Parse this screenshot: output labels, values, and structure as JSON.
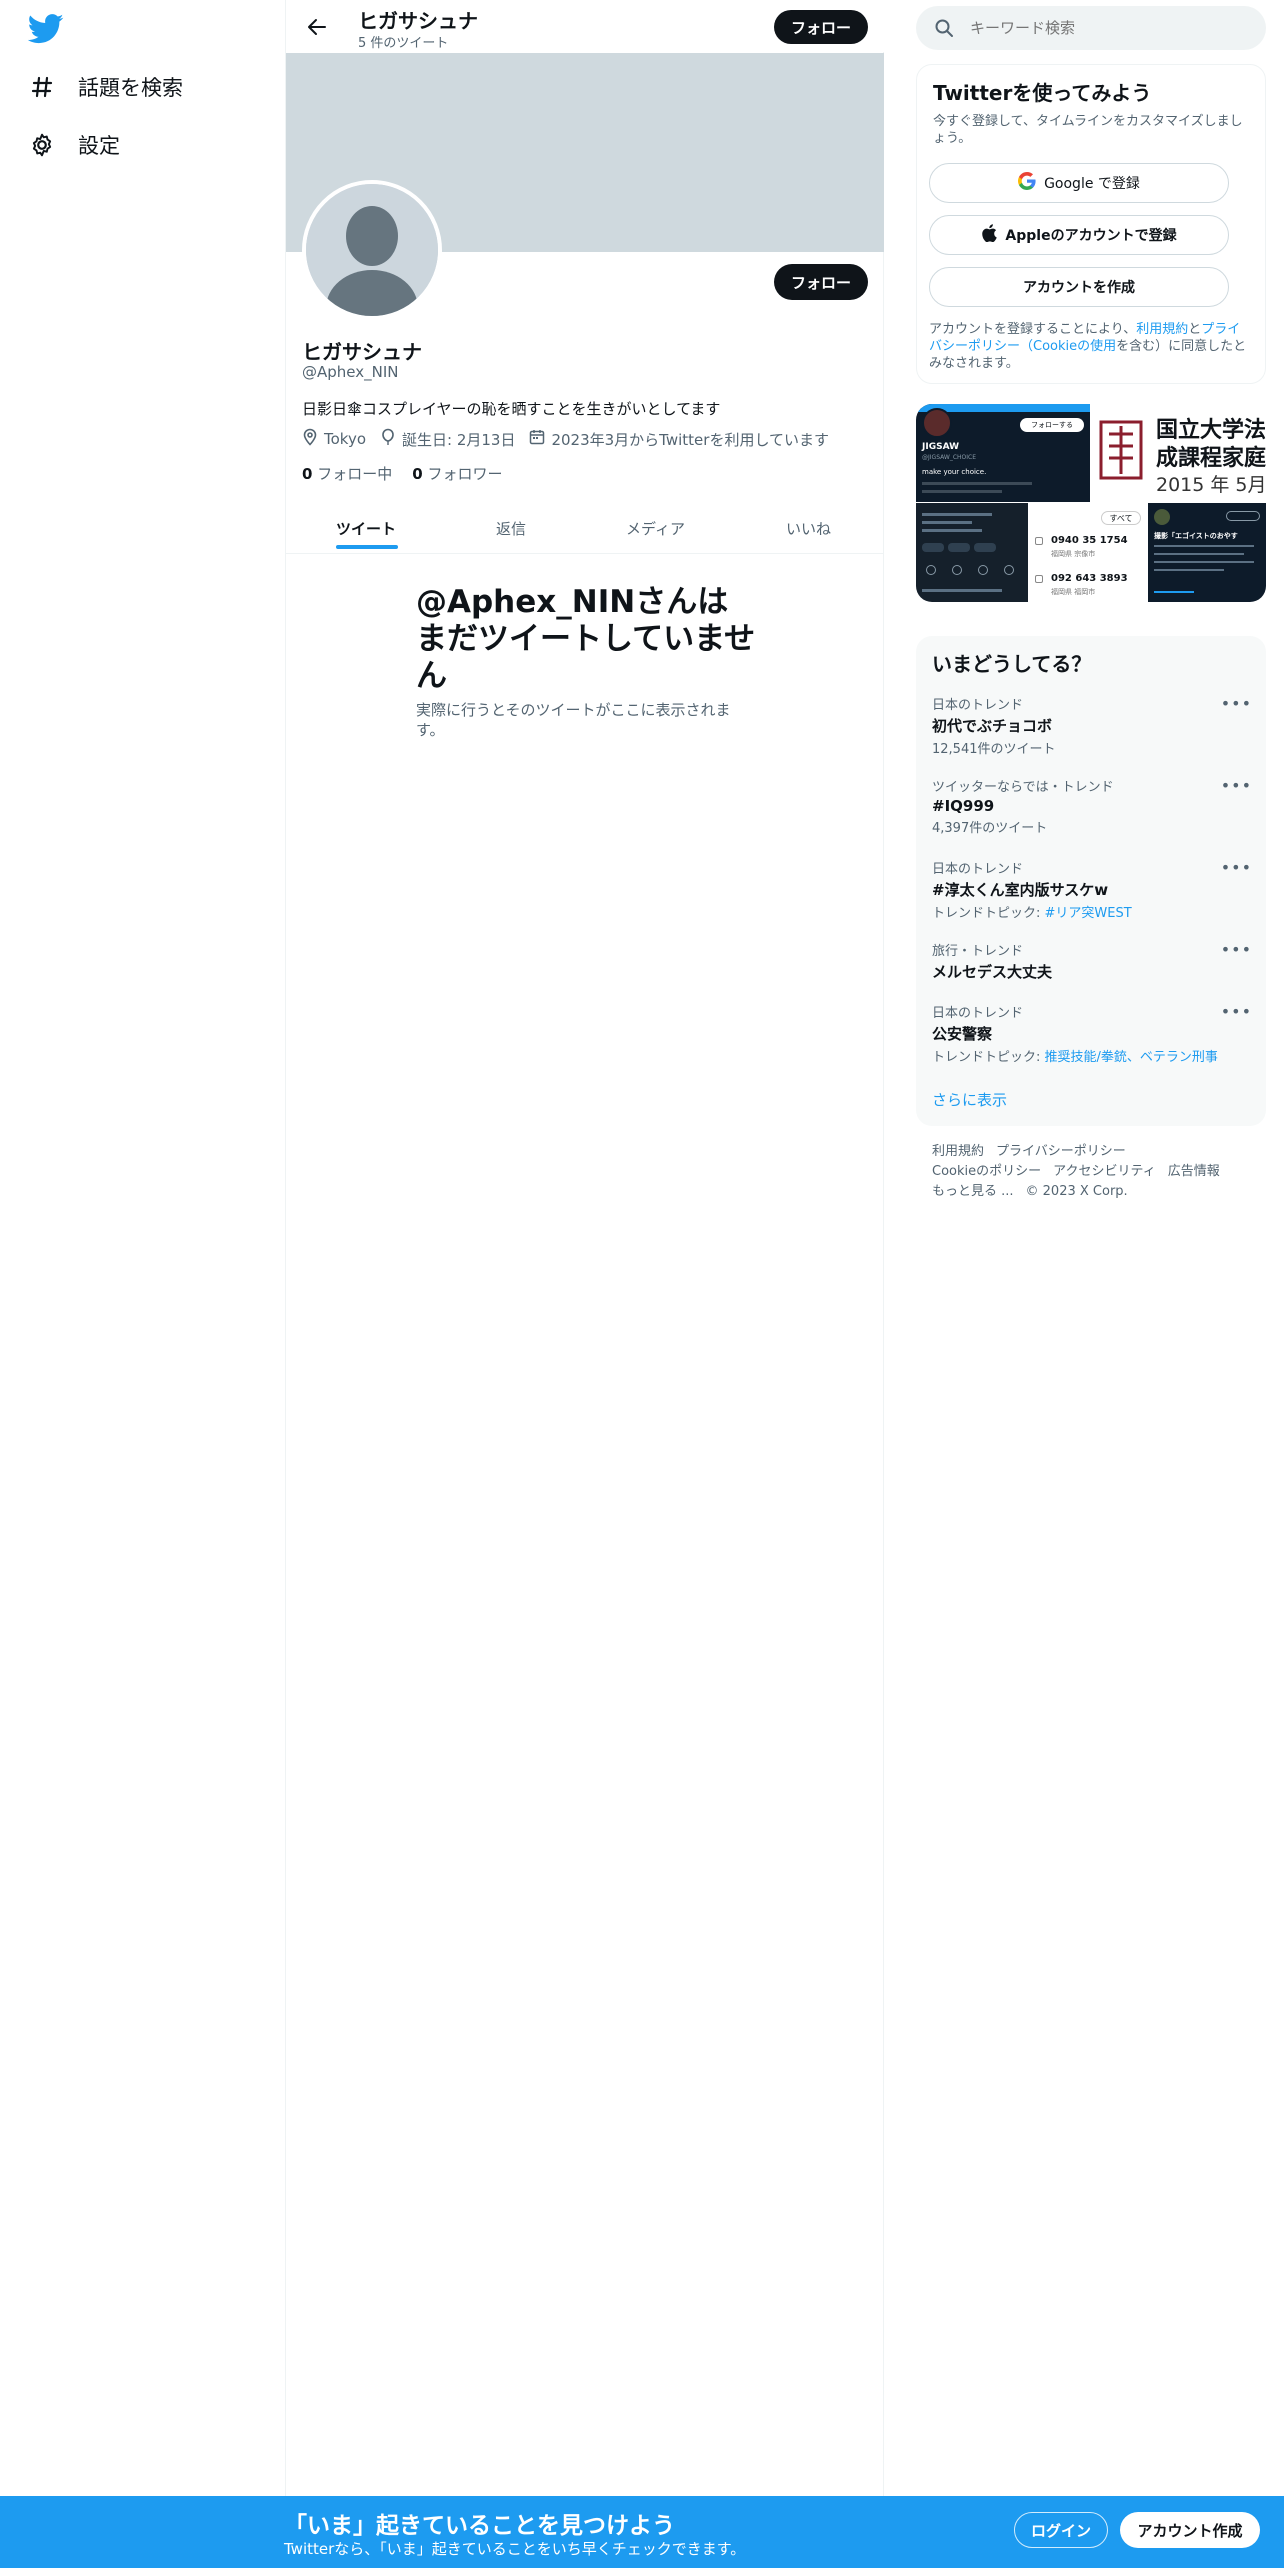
{
  "sidebar": {
    "logo": "twitter-bird-icon",
    "items": [
      {
        "icon": "hashtag-icon",
        "label": "話題を検索"
      },
      {
        "icon": "gear-icon",
        "label": "設定"
      }
    ]
  },
  "header": {
    "name": "ヒガサシュナ",
    "tweet_count": "5 件のツイート",
    "follow_label": "フォロー"
  },
  "profile": {
    "follow_label": "フォロー",
    "display_name": "ヒガサシュナ",
    "handle": "@Aphex_NIN",
    "bio": "日影日傘コスプレイヤーの恥を晒すことを生きがいとしてます",
    "location": "Tokyo",
    "birthday": "誕生日: 2月13日",
    "joined": "2023年3月からTwitterを利用しています",
    "following_count": "0",
    "following_label": "フォロー中",
    "followers_count": "0",
    "followers_label": "フォロワー"
  },
  "tabs": [
    "ツイート",
    "返信",
    "メディア",
    "いいね"
  ],
  "empty_state": {
    "title": "@Aphex_NINさんはまだツイートしていません",
    "subtitle": "実際に行うとそのツイートがここに表示されます。"
  },
  "search": {
    "placeholder": "キーワード検索"
  },
  "signup_box": {
    "title": "Twitterを使ってみよう",
    "subtitle": "今すぐ登録して、タイムラインをカスタマイズしましょう。",
    "google_label": "Google で登録",
    "apple_label": "Appleのアカウントで登録",
    "create_label": "アカウントを作成",
    "legal_pre": "アカウントを登録することにより、",
    "legal_terms": "利用規約",
    "legal_and": "と",
    "legal_privacy": "プライバシーポリシー（Cookieの使用",
    "legal_post": "を含む）に同意したとみなされます。"
  },
  "media": {
    "tile1_name": "JIGSAW",
    "tile1_handle": "@JIGSAW_CHOICE",
    "tile1_text": "make your choice.",
    "tile1_button": "フォローする",
    "tile3_line1": "国立大学法",
    "tile3_line2": "成課程家庭",
    "tile3_line3": "2015 年 5月〜",
    "tile5_button": "すべて",
    "tile5_phone1": "0940 35 1754",
    "tile5_place1": "福岡県 宗像市",
    "tile5_phone2": "092 643 3893",
    "tile5_place2": "福岡県 福岡市",
    "tile6_title": "撮影「エゴイストのおやす"
  },
  "trends": {
    "title": "いまどうしてる？",
    "items": [
      {
        "context": "日本のトレンド",
        "name": "初代でぶチョコボ",
        "count": "12,541件のツイート"
      },
      {
        "context": "ツイッターならでは・トレンド",
        "name": "#IQ999",
        "count": "4,397件のツイート"
      },
      {
        "context": "日本のトレンド",
        "name": "#淳太くん室内版サスケw",
        "topic_label": "トレンドトピック: ",
        "topic": "#リア突WEST"
      },
      {
        "context": "旅行・トレンド",
        "name": "メルセデス大丈夫"
      },
      {
        "context": "日本のトレンド",
        "name": "公安警察",
        "topic_label": "トレンドトピック: ",
        "topic": "推奨技能/拳銃、ベテラン刑事"
      }
    ],
    "show_more": "さらに表示"
  },
  "footer": {
    "links": [
      "利用規約",
      "プライバシーポリシー",
      "Cookieのポリシー",
      "アクセシビリティ",
      "広告情報",
      "もっと見る ..."
    ],
    "copyright": "© 2023 X Corp."
  },
  "bottom_bar": {
    "title": "「いま」起きていることを見つけよう",
    "subtitle": "Twitterなら、「いま」起きていることをいち早くチェックできます。",
    "login_label": "ログイン",
    "signup_label": "アカウント作成"
  },
  "colors": {
    "accent": "#1d9bf0",
    "dark": "#0f1419",
    "banner": "#cfd9de",
    "muted": "#536471"
  }
}
